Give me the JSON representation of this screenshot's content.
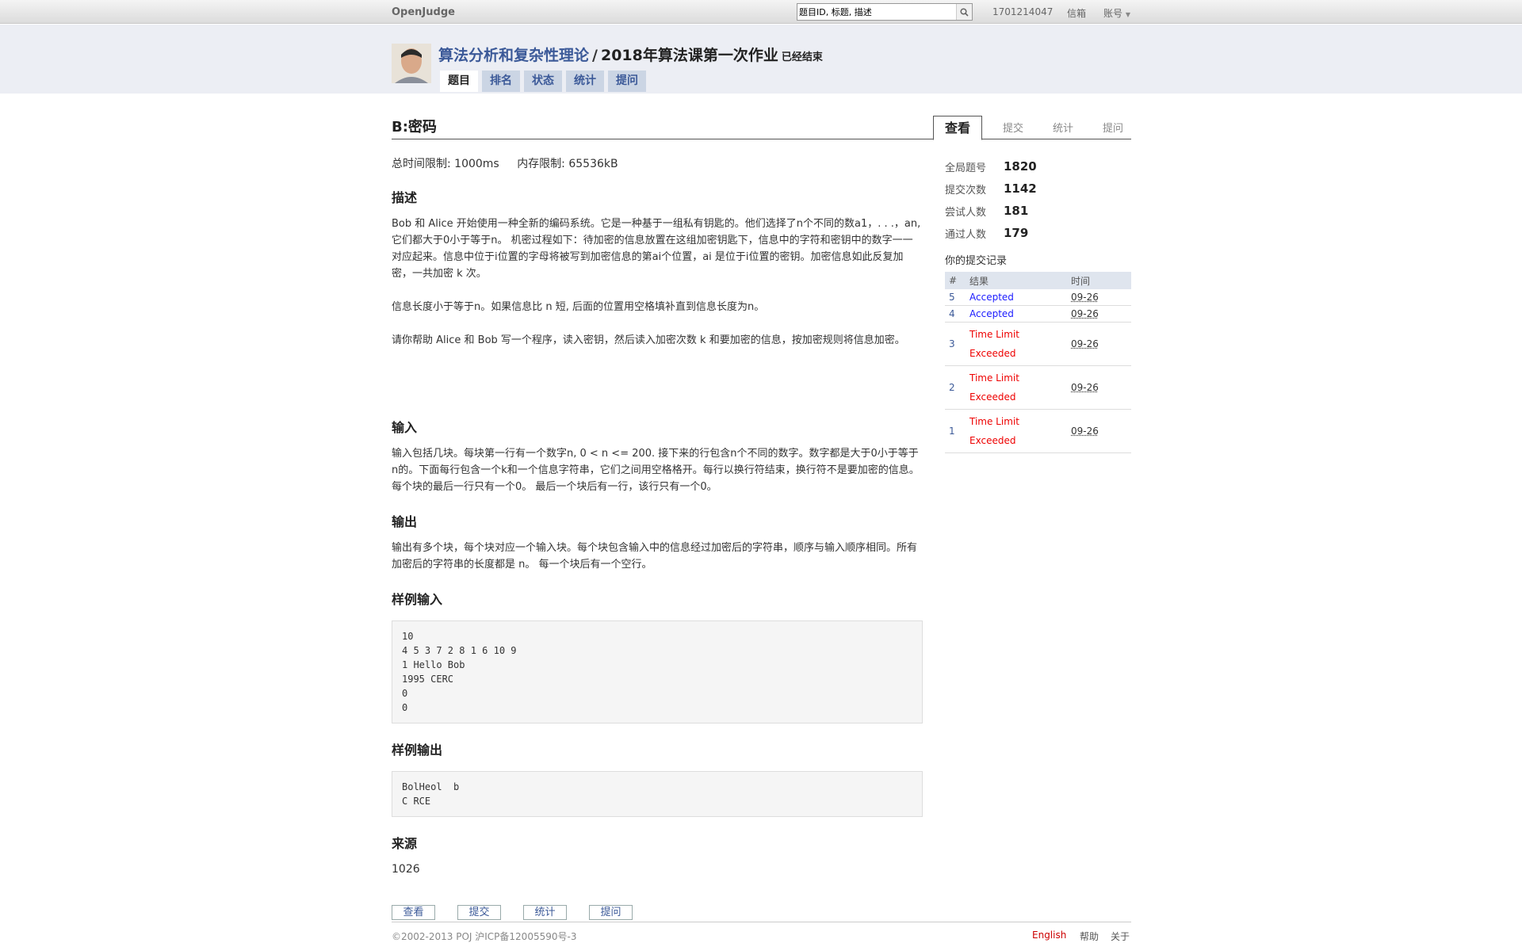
{
  "topbar": {
    "brand": "OpenJudge",
    "search_placeholder": "题目ID, 标题, 描述",
    "user": "1701214047",
    "mail": "信箱",
    "account": "账号"
  },
  "header": {
    "course": "算法分析和复杂性理论",
    "separator": "/",
    "contest": "2018年算法课第一次作业",
    "status": "已经结束",
    "tabs": [
      "题目",
      "排名",
      "状态",
      "统计",
      "提问"
    ]
  },
  "problem": {
    "title": "B:密码",
    "time_limit": "总时间限制: 1000ms",
    "mem_limit": "内存限制: 65536kB",
    "desc_head": "描述",
    "desc_p1": "Bob 和 Alice 开始使用一种全新的编码系统。它是一种基于一组私有钥匙的。他们选择了n个不同的数a1，. . .，an, 它们都大于0小于等于n。 机密过程如下：待加密的信息放置在这组加密钥匙下，信息中的字符和密钥中的数字一一对应起来。信息中位于i位置的字母将被写到加密信息的第ai个位置，ai 是位于i位置的密钥。加密信息如此反复加密，一共加密 k 次。",
    "desc_p2": "信息长度小于等于n。如果信息比 n 短, 后面的位置用空格填补直到信息长度为n。",
    "desc_p3": "请你帮助 Alice 和 Bob 写一个程序，读入密钥，然后读入加密次数 k 和要加密的信息，按加密规则将信息加密。",
    "input_head": "输入",
    "input_text": "输入包括几块。每块第一行有一个数字n, 0 < n <= 200. 接下来的行包含n个不同的数字。数字都是大于0小于等于n的。下面每行包含一个k和一个信息字符串，它们之间用空格格开。每行以换行符结束，换行符不是要加密的信息。每个块的最后一行只有一个0。 最后一个块后有一行，该行只有一个0。",
    "output_head": "输出",
    "output_text": "输出有多个块，每个块对应一个输入块。每个块包含输入中的信息经过加密后的字符串，顺序与输入顺序相同。所有加密后的字符串的长度都是 n。 每一个块后有一个空行。",
    "sample_in_head": "样例输入",
    "sample_in": "10\n4 5 3 7 2 8 1 6 10 9\n1 Hello Bob\n1995 CERC\n0\n0",
    "sample_out_head": "样例输出",
    "sample_out": "BolHeol  b\nC RCE",
    "source_head": "来源",
    "source": "1026"
  },
  "side_tabs": [
    "查看",
    "提交",
    "统计",
    "提问"
  ],
  "stats": [
    {
      "label": "全局题号",
      "value": "1820"
    },
    {
      "label": "提交次数",
      "value": "1142"
    },
    {
      "label": "尝试人数",
      "value": "181"
    },
    {
      "label": "通过人数",
      "value": "179"
    }
  ],
  "history": {
    "title": "你的提交记录",
    "headers": [
      "#",
      "结果",
      "时间"
    ],
    "rows": [
      {
        "n": "5",
        "result": "Accepted",
        "time": "09-26"
      },
      {
        "n": "4",
        "result": "Accepted",
        "time": "09-26"
      },
      {
        "n": "3",
        "result": "Time Limit Exceeded",
        "time": "09-26"
      },
      {
        "n": "2",
        "result": "Time Limit Exceeded",
        "time": "09-26"
      },
      {
        "n": "1",
        "result": "Time Limit Exceeded",
        "time": "09-26"
      }
    ]
  },
  "bottom_buttons": [
    "查看",
    "提交",
    "统计",
    "提问"
  ],
  "footer": {
    "copyright": "©2002-2013 POJ 沪ICP备12005590号-3",
    "english": "English",
    "help": "帮助",
    "about": "关于"
  },
  "colors": {
    "link": "#3b5998",
    "accepted": "#1a1aff",
    "tle": "#e00000",
    "header_bg": "#eceef4"
  }
}
